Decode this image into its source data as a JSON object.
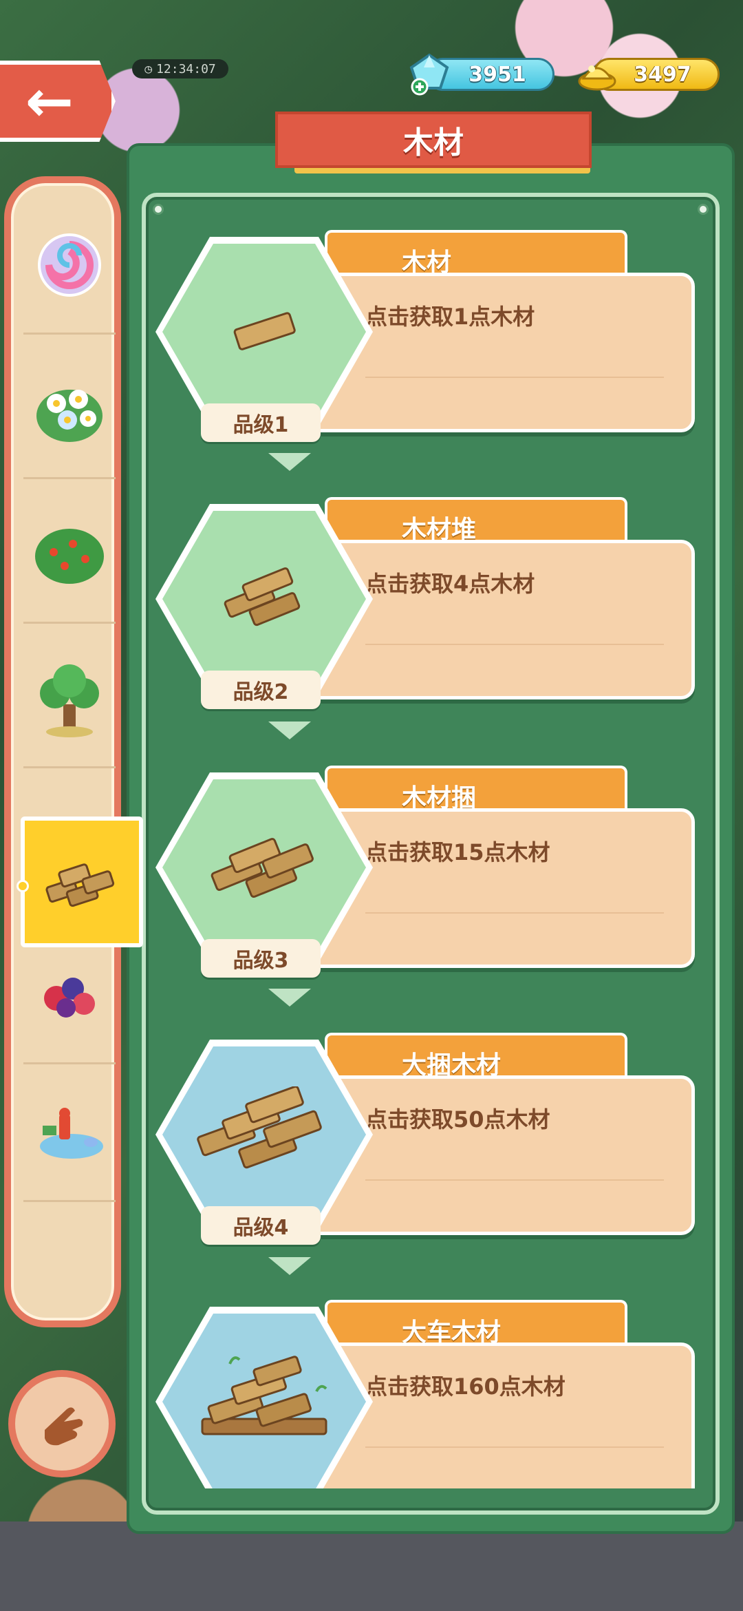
{
  "hud": {
    "timer": "12:34:07",
    "gems": "3951",
    "gold": "3497"
  },
  "panel": {
    "title": "木材"
  },
  "sidebar": {
    "items": [
      {
        "icon": "candy-orb-icon"
      },
      {
        "icon": "flower-bush-icon"
      },
      {
        "icon": "fruit-bush-icon"
      },
      {
        "icon": "tree-icon"
      },
      {
        "icon": "wood-logs-icon",
        "selected": true
      },
      {
        "icon": "berries-icon"
      },
      {
        "icon": "hydrant-pond-icon"
      }
    ]
  },
  "items": [
    {
      "name": "木材",
      "desc": "点击获取1点木材",
      "grade": "品级1",
      "bg": "green"
    },
    {
      "name": "木材堆",
      "desc": "点击获取4点木材",
      "grade": "品级2",
      "bg": "green"
    },
    {
      "name": "木材捆",
      "desc": "点击获取15点木材",
      "grade": "品级3",
      "bg": "green"
    },
    {
      "name": "大捆木材",
      "desc": "点击获取50点木材",
      "grade": "品级4",
      "bg": "blue"
    },
    {
      "name": "大车木材",
      "desc": "点击获取160点木材",
      "grade": "",
      "bg": "blue"
    }
  ],
  "colors": {
    "panel_green": "#3f8a5b",
    "banner_red": "#e05a45",
    "tab_orange": "#f3a13b",
    "card_peach": "#f6d2ab",
    "text_brown": "#7d4a2a",
    "selected_yellow": "#ffcf2b"
  }
}
